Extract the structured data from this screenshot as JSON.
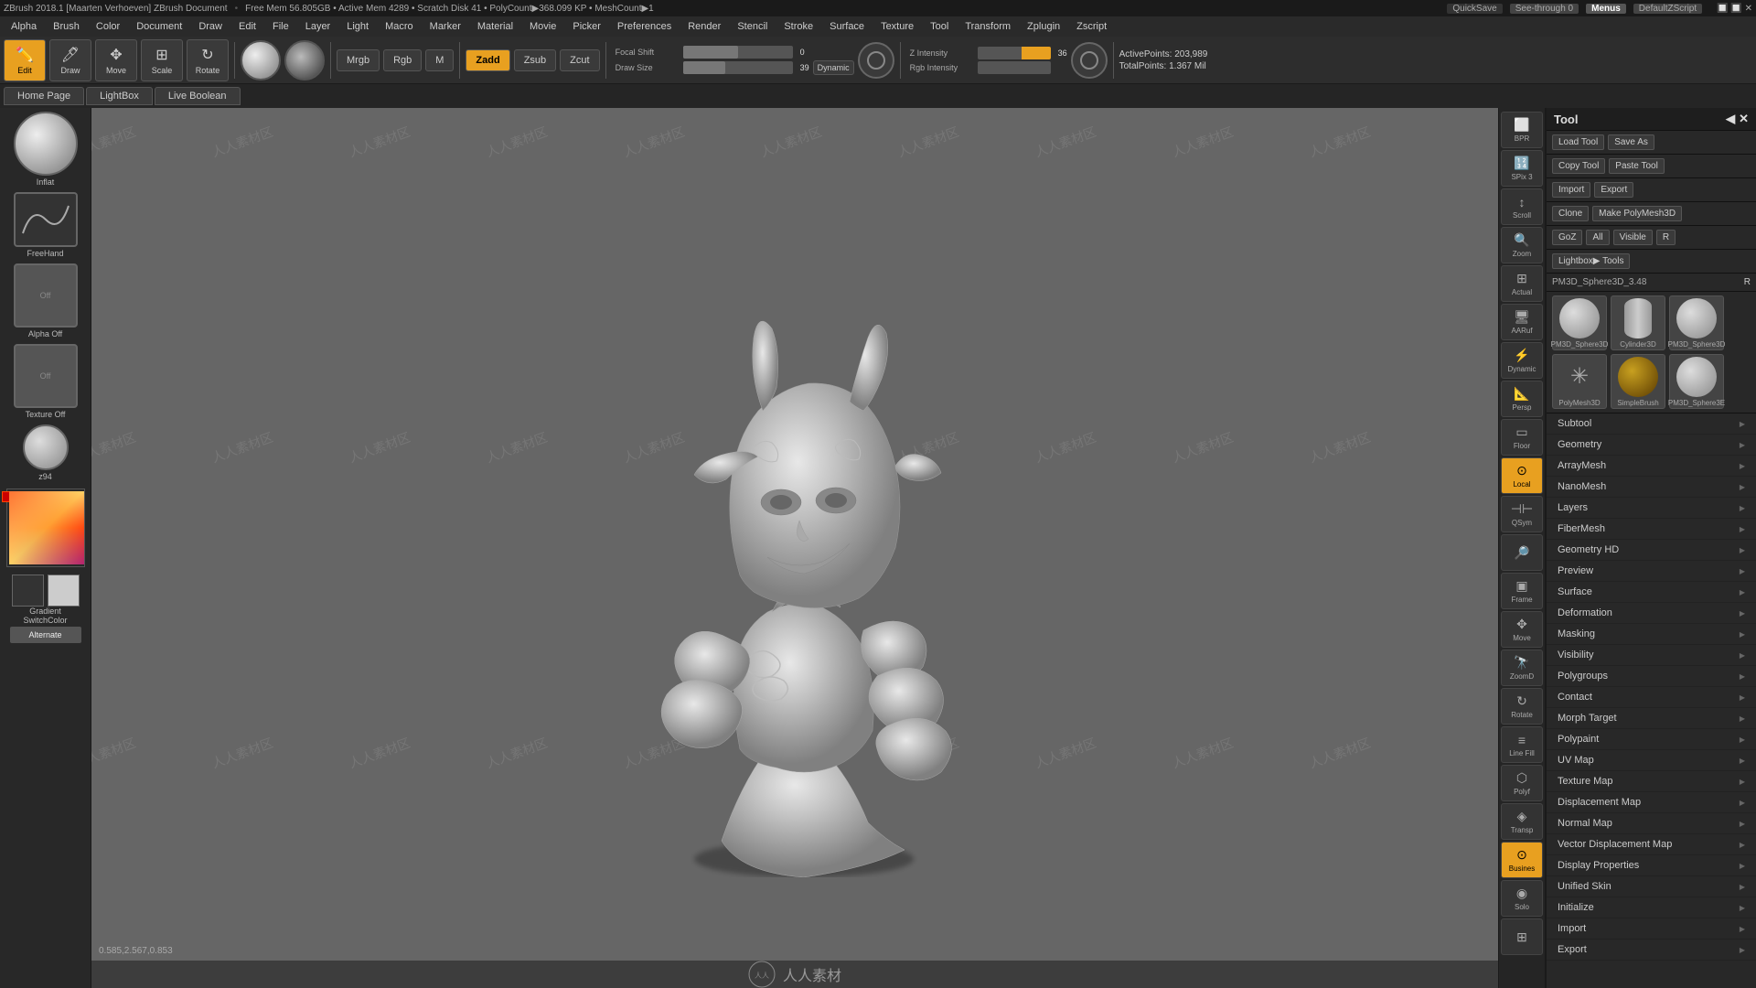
{
  "window": {
    "title": "ZBrush 2018.1 [Maarten Verhoeven]  ZBrush Document",
    "memory": "Free Mem 56.805GB",
    "active_mem": "Active Mem 4289",
    "scratch_disk": "Scratch Disk 41",
    "poly_count": "PolyCount▶368.099 KP",
    "mesh_count": "MeshCount▶1"
  },
  "top_bar": {
    "title": "ZBrush 2018.1 [Maarten Verhoeven]  ZBrush Document",
    "quick_save": "QuickSave",
    "see_through": "See-through 0",
    "menus": "Menus",
    "default_zscript": "DefaultZScript",
    "stats": "Free Mem 56.805GB • Active Mem 4289 • Scratch Disk 41 • PolyCount▶368.099 KP • MeshCount▶1"
  },
  "menu_bar": {
    "items": [
      "Alpha",
      "Brush",
      "Color",
      "Document",
      "Draw",
      "Edit",
      "File",
      "Layer",
      "Light",
      "Macro",
      "Marker",
      "Material",
      "Movie",
      "Picker",
      "Preferences",
      "Render",
      "Stencil",
      "Stroke",
      "Surface",
      "Texture",
      "Tool",
      "Transform",
      "Zplugin",
      "Zscript"
    ]
  },
  "toolbar": {
    "buttons": [
      "Edit",
      "Draw",
      "Move",
      "Scale",
      "Rotate"
    ],
    "material_sphere": "MatCap",
    "rgb_mode": "Rgb",
    "mrgb_mode": "Mrgb",
    "m_mode": "M",
    "zadd": "Zadd",
    "zsub": "Zsub",
    "zcut": "Zcut",
    "focal_shift_label": "Focal Shift",
    "focal_shift_val": "0",
    "draw_size_label": "Draw Size",
    "draw_size_val": "39",
    "dynamic_label": "Dynamic",
    "z_intensity_label": "Z Intensity",
    "z_intensity_val": "36",
    "rgb_intensity_label": "Rgb Intensity",
    "active_points": "ActivePoints: 203,989",
    "total_points": "TotalPoints: 1.367 Mil"
  },
  "tabs": {
    "items": [
      "Home Page",
      "LightBox",
      "Live Boolean"
    ]
  },
  "left_panel": {
    "tools": [
      {
        "label": "Inflat",
        "type": "sphere"
      },
      {
        "label": "FreeHand",
        "type": "stroke"
      },
      {
        "label": "Alpha Off",
        "type": "flat"
      },
      {
        "label": "Texture Off",
        "type": "flat"
      },
      {
        "label": "z94",
        "type": "sphere_small"
      },
      {
        "label": "Gradient",
        "type": "gradient"
      },
      {
        "label": "SwitchColor",
        "type": "swatches"
      },
      {
        "label": "Alternate",
        "type": "alternate"
      }
    ]
  },
  "canvas": {
    "watermarks": [
      "人人素材区",
      "人人素材区",
      "人人素材区",
      "人人素材区",
      "人人素材区",
      "人人素材区"
    ],
    "coord": "0.585,2.567,0.853",
    "logo_text": "人人素材",
    "bottom_text": "人人素材"
  },
  "right_icons": [
    {
      "icon": "🖼",
      "label": "BPR"
    },
    {
      "icon": "🔢",
      "label": "SPix 3"
    },
    {
      "icon": "📜",
      "label": "Scroll"
    },
    {
      "icon": "🔍",
      "label": "Zoom"
    },
    {
      "icon": "📐",
      "label": "Actual"
    },
    {
      "icon": "💻",
      "label": "AARuf"
    },
    {
      "icon": "⚡",
      "label": "Dynamic"
    },
    {
      "icon": "📝",
      "label": "Persp"
    },
    {
      "icon": "🔲",
      "label": "Floor"
    },
    {
      "icon": "🌐",
      "label": "Local"
    },
    {
      "icon": "✨",
      "label": "QSym"
    },
    {
      "icon": "🔎",
      "label": ""
    },
    {
      "icon": "🎨",
      "label": "Frame"
    },
    {
      "icon": "🖱",
      "label": "Move"
    },
    {
      "icon": "🔄",
      "label": "ZoomD"
    },
    {
      "icon": "↩",
      "label": "Rotate"
    },
    {
      "icon": "📋",
      "label": "Line Fill"
    },
    {
      "icon": "🔷",
      "label": "Polyf"
    },
    {
      "icon": "🚚",
      "label": "Transp"
    },
    {
      "icon": "🔵",
      "label": "Busines"
    },
    {
      "icon": "⬜",
      "label": "Solo"
    }
  ],
  "right_panel": {
    "header": "Tool",
    "header_icons": [
      "◀",
      "✕"
    ],
    "buttons": {
      "load_tool": "Load Tool",
      "save_as": "Save As",
      "copy_tool": "Copy Tool",
      "paste_tool": "Paste Tool",
      "import": "Import",
      "export": "Export",
      "clone": "Clone",
      "make_polymesh": "Make PolyMesh3D",
      "goz": "GoZ",
      "all": "All",
      "visible": "Visible",
      "r": "R",
      "lightbox_tools": "Lightbox▶ Tools"
    },
    "current_tool": "PM3D_Sphere3D_3.48",
    "r_shortcut": "R",
    "tool_list": [
      {
        "label": "PM3D_Sphere3D",
        "type": "sphere"
      },
      {
        "label": "Cylinder3D",
        "type": "cylinder"
      },
      {
        "label": "PM3D_Sphere3D",
        "type": "sphere"
      },
      {
        "label": "PolyMesh3D",
        "type": "star"
      },
      {
        "label": "SimpleBrush",
        "type": "simple"
      },
      {
        "label": "PM3D_Sphere3E",
        "type": "sphere"
      }
    ],
    "menu_items": [
      {
        "label": "Subtool"
      },
      {
        "label": "Geometry"
      },
      {
        "label": "ArrayMesh"
      },
      {
        "label": "NanoMesh"
      },
      {
        "label": "Layers"
      },
      {
        "label": "FiberMesh"
      },
      {
        "label": "Geometry HD"
      },
      {
        "label": "Preview"
      },
      {
        "label": "Surface"
      },
      {
        "label": "Deformation"
      },
      {
        "label": "Masking"
      },
      {
        "label": "Visibility"
      },
      {
        "label": "Polygroups"
      },
      {
        "label": "Contact"
      },
      {
        "label": "Morph Target"
      },
      {
        "label": "Polypaint"
      },
      {
        "label": "UV Map"
      },
      {
        "label": "Texture Map"
      },
      {
        "label": "Displacement Map"
      },
      {
        "label": "Normal Map"
      },
      {
        "label": "Vector Displacement Map"
      },
      {
        "label": "Display Properties"
      },
      {
        "label": "Unified Skin"
      },
      {
        "label": "Initialize"
      },
      {
        "label": "Import"
      },
      {
        "label": "Export"
      }
    ]
  }
}
